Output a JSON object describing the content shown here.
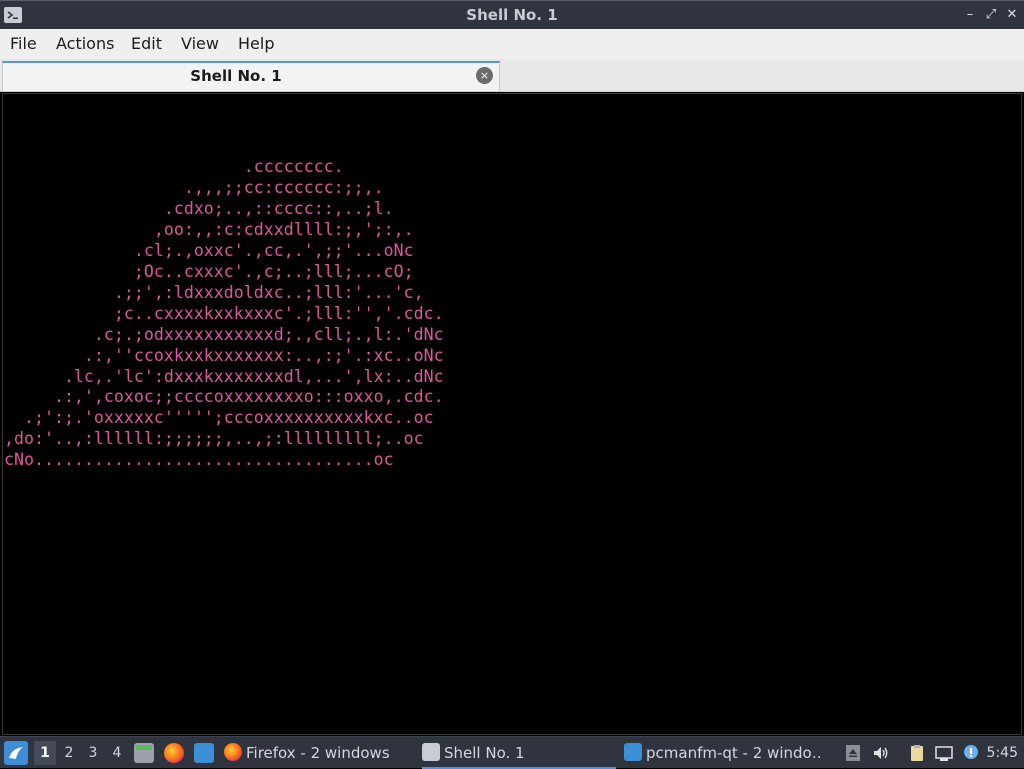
{
  "window": {
    "title": "Shell No. 1",
    "controls": {
      "minimize": "–",
      "maximize": "⤢",
      "close": "✕"
    }
  },
  "menu": {
    "items": [
      "File",
      "Actions",
      "Edit",
      "View",
      "Help"
    ]
  },
  "tabs": [
    {
      "label": "Shell No. 1",
      "close_icon": "×"
    }
  ],
  "terminal": {
    "fg_color": "#e0559f",
    "bg_color": "#000000",
    "lines": [
      "                        .cccccccc.",
      "                  .,,,;;cc:cccccc:;;,.",
      "                .cdxo;..,::cccc::,..;l.",
      "               ,oo:,,:c:cdxxdllll:;,';:,.",
      "             .cl;.,oxxc'.,cc,.',;;'...oNc",
      "             ;Oc..cxxxc'.,c;..;lll;...cO;",
      "           .;;',:ldxxxdoldxc..;lll:'...'c,",
      "           ;c..cxxxxkxxkxxxc'.;lll:'','.cdc.",
      "         .c;.;odxxxxxxxxxxxd;.,cll;.,l:.'dNc",
      "        .:,''ccoxkxxkxxxxxxx:..,:;'.:xc..oNc",
      "      .lc,.'lc':dxxxkxxxxxxxdl,...',lx:..dNc",
      "     .:,',coxoc;;ccccoxxxxxxxxo:::oxxo,.cdc.",
      "  .;':;.'oxxxxxc''''';cccoxxxxxxxxxxkxc..oc",
      ",do:'..,:llllll:;;;;;;,..,;:lllllllll;..oc",
      "cNo..................................oc"
    ]
  },
  "taskbar": {
    "desktops": [
      "1",
      "2",
      "3",
      "4"
    ],
    "active_desktop": "1",
    "quicklaunch": [
      "file-manager-icon",
      "firefox-icon",
      "show-desktop-icon"
    ],
    "tasks": [
      {
        "label": "Firefox - 2 windows",
        "icon": "firefox-icon"
      },
      {
        "label": "Shell No. 1",
        "icon": "terminal-icon",
        "active": true
      },
      {
        "label": "pcmanfm-qt - 2 windo…",
        "icon": "folder-icon"
      }
    ],
    "tray": [
      "eject-icon",
      "volume-icon",
      "clipboard-icon",
      "network-icon",
      "update-icon"
    ],
    "clock": "5:45"
  }
}
